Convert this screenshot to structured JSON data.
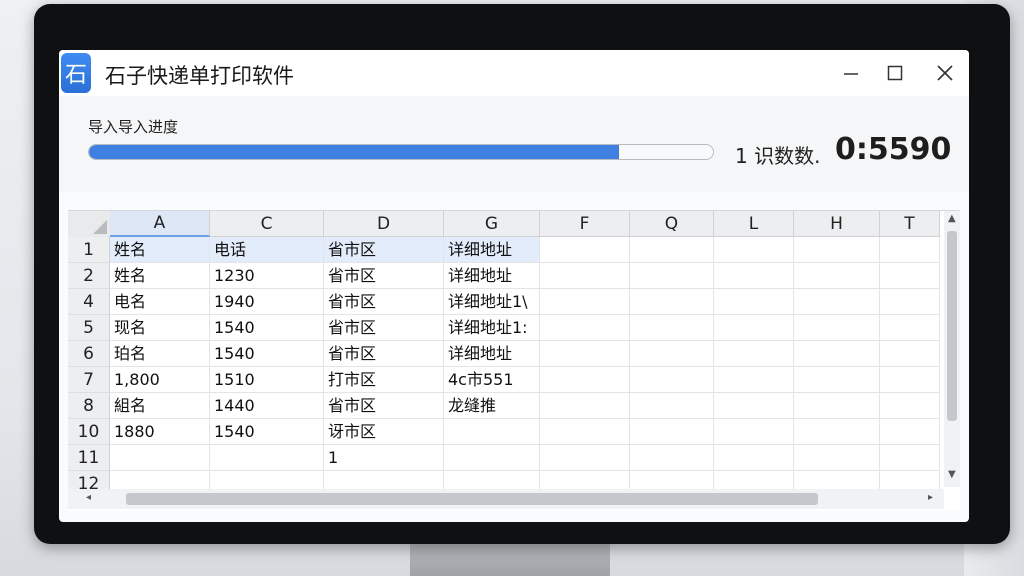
{
  "window": {
    "icon_glyph": "石",
    "title": "石子快递单打印软件",
    "controls": [
      "minimize-icon",
      "maximize-icon",
      "close-icon"
    ]
  },
  "progress": {
    "label": "导入导入进度",
    "fraction": 0.85,
    "count_label": "1 识数数.",
    "count_value": "0:5590",
    "fill_color": "#3f7fe0"
  },
  "sheet": {
    "columns": [
      "A",
      "C",
      "D",
      "G",
      "F",
      "Q",
      "L",
      "H",
      "T"
    ],
    "selected_column": "A",
    "rows": [
      {
        "num": "1",
        "cells": [
          "姓名",
          "电话",
          "省市区",
          "详细地址"
        ]
      },
      {
        "num": "2",
        "cells": [
          "姓名",
          "1230",
          "省市区",
          "详细地址"
        ]
      },
      {
        "num": "4",
        "cells": [
          "电名",
          "1940",
          "省市区",
          "详细地址1\\"
        ]
      },
      {
        "num": "5",
        "cells": [
          "现名",
          "1540",
          "省市区",
          "详细地址1:"
        ]
      },
      {
        "num": "6",
        "cells": [
          "珀名",
          "1540",
          "省市区",
          "详细地址"
        ]
      },
      {
        "num": "7",
        "cells": [
          "1,800",
          "1510",
          "打市区",
          "4c市551"
        ]
      },
      {
        "num": "8",
        "cells": [
          "組名",
          "1440",
          "省市区",
          "龙缝推"
        ]
      },
      {
        "num": "10",
        "cells": [
          "1880",
          "1540",
          "讶市区",
          ""
        ]
      },
      {
        "num": "11",
        "cells": [
          "",
          "",
          "1",
          ""
        ]
      },
      {
        "num": "12",
        "cells": [
          "",
          "",
          "",
          ""
        ]
      }
    ],
    "scroll_icons": [
      "arrow-up-icon",
      "arrow-down-icon",
      "arrow-left-icon",
      "arrow-right-icon"
    ]
  }
}
